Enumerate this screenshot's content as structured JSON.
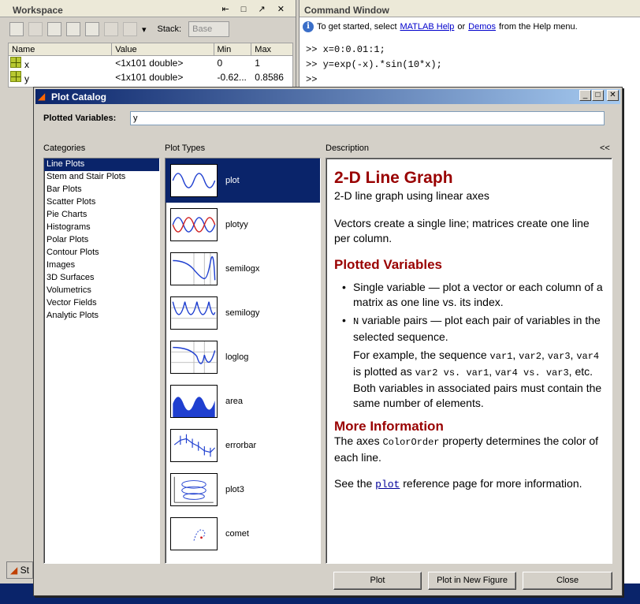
{
  "workspace": {
    "title": "Workspace",
    "window_buttons": "⇤ □ ↗ ✕",
    "stack_label": "Stack:",
    "stack_value": "Base",
    "columns": [
      "Name",
      "Value",
      "Min",
      "Max"
    ],
    "rows": [
      {
        "name": "x",
        "value": "<1x101 double>",
        "min": "0",
        "max": "1"
      },
      {
        "name": "y",
        "value": "<1x101 double>",
        "min": "-0.62...",
        "max": "0.8586"
      }
    ]
  },
  "command_window": {
    "title": "Command Window",
    "help_prefix": "To get started, select",
    "help_link1": "MATLAB Help",
    "help_or": "or",
    "help_link2": "Demos",
    "help_suffix": "from the Help menu.",
    "lines": [
      ">> x=0:0.01:1;",
      ">> y=exp(-x).*sin(10*x);",
      ">>"
    ]
  },
  "taskbar": {
    "start_label": "St"
  },
  "dialog": {
    "title": "Plot Catalog",
    "plotted_label": "Plotted Variables:",
    "plotted_value": "y",
    "categories_header": "Categories",
    "types_header": "Plot Types",
    "desc_header": "Description",
    "collapse_glyph": "<<",
    "categories": [
      "Line Plots",
      "Stem and Stair Plots",
      "Bar Plots",
      "Scatter Plots",
      "Pie Charts",
      "Histograms",
      "Polar Plots",
      "Contour Plots",
      "Images",
      "3D Surfaces",
      "Volumetrics",
      "Vector Fields",
      "Analytic Plots"
    ],
    "selected_category": 0,
    "plot_types": [
      "plot",
      "plotyy",
      "semilogx",
      "semilogy",
      "loglog",
      "area",
      "errorbar",
      "plot3",
      "comet"
    ],
    "selected_type": 0,
    "description": {
      "heading": "2-D Line Graph",
      "subheading": "2-D line graph using linear axes",
      "p1": "Vectors create a single line; matrices create one line per column.",
      "h2a": "Plotted Variables",
      "bullet1": "Single variable — plot a vector or each column of a matrix as one line vs. its index.",
      "bullet2_code": "N",
      "bullet2_text": " variable pairs — plot each pair of variables in the selected sequence.",
      "ex_text1": "For example, the sequence ",
      "ex_code1": "var1",
      "ex_code2": "var2",
      "ex_code3": "var3",
      "ex_code4": "var4",
      "ex_text2": " is plotted as ",
      "ex_code5": "var2",
      "ex_vs": " vs. ",
      "ex_code6": "var1",
      "ex_code7": "var4",
      "ex_code8": "var3",
      "ex_text3": ", etc. Both variables in associated pairs must contain the same number of elements.",
      "h2b": "More Information",
      "mi_text1": "The axes ",
      "mi_code": "ColorOrder",
      "mi_text2": " property determines the color of each line.",
      "see_text1": "See the ",
      "see_link": "plot",
      "see_text2": " reference page for more information."
    },
    "buttons": {
      "plot": "Plot",
      "plot_new": "Plot in New Figure",
      "close": "Close"
    }
  },
  "colors": {
    "selection": "#0a246a",
    "heading": "#990000",
    "link": "#0000cc"
  }
}
